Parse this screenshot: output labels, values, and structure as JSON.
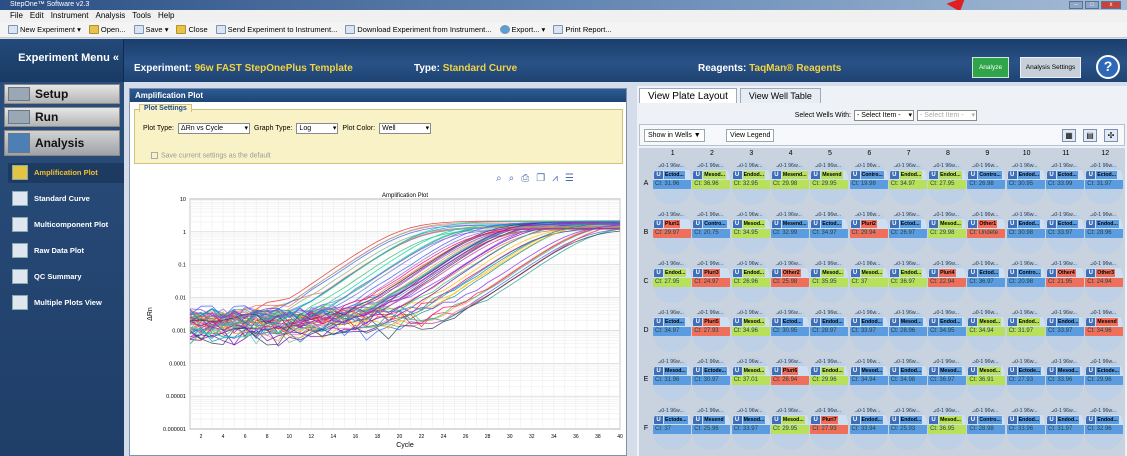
{
  "window": {
    "title": "StepOne™ Software v2.3"
  },
  "menu": [
    "File",
    "Edit",
    "Instrument",
    "Analysis",
    "Tools",
    "Help"
  ],
  "toolbar": {
    "new_experiment": "New Experiment",
    "open": "Open...",
    "save": "Save",
    "close": "Close",
    "send": "Send Experiment to Instrument...",
    "download": "Download Experiment from Instrument...",
    "export": "Export...",
    "print": "Print Report..."
  },
  "header": {
    "experiment_menu": "Experiment Menu «",
    "experiment_label": "Experiment:",
    "experiment_value": "96w FAST StepOnePlus Template",
    "type_label": "Type:",
    "type_value": "Standard Curve",
    "reagents_label": "Reagents:",
    "reagents_value": "TaqMan® Reagents",
    "analyze": "Analyze",
    "analysis_settings": "Analysis Settings",
    "help": "?"
  },
  "sidebar": {
    "setup": "Setup",
    "run": "Run",
    "analysis": "Analysis",
    "items": [
      "Amplification Plot",
      "Standard Curve",
      "Multicomponent Plot",
      "Raw Data Plot",
      "QC Summary",
      "Multiple Plots View"
    ]
  },
  "left_panel": {
    "title": "Amplification Plot",
    "settings_tab": "Plot Settings",
    "plot_type_label": "Plot Type:",
    "plot_type": "ΔRn vs Cycle",
    "graph_type_label": "Graph Type:",
    "graph_type": "Log",
    "plot_color_label": "Plot Color:",
    "plot_color": "Well",
    "save_default": "Save current settings as the default"
  },
  "chart_data": {
    "type": "line",
    "title": "Amplification Plot",
    "xlabel": "Cycle",
    "ylabel": "ΔRn",
    "y_scale": "log",
    "ylim": [
      1e-06,
      10
    ],
    "xlim": [
      1,
      40
    ],
    "ytick_labels": [
      "10",
      "1",
      "0.1",
      "0.01",
      "0.001",
      "0.0001",
      "0.00001",
      "0.000001"
    ],
    "xtick_labels": [
      "2",
      "4",
      "6",
      "8",
      "10",
      "12",
      "14",
      "16",
      "18",
      "20",
      "22",
      "24",
      "26",
      "28",
      "30",
      "32",
      "34",
      "36",
      "38",
      "40"
    ],
    "grid": true,
    "series_note": "",
    "threshold_range_ct": [
      20,
      38
    ],
    "plateau": 2
  },
  "right_panel": {
    "tab_plate": "View Plate Layout",
    "tab_table": "View Well Table",
    "select_label": "Select Wells With:",
    "select1": "- Select Item -",
    "select2": "- Select Item -",
    "show_in_wells": "Show in Wells ▼",
    "view_legend": "View Legend"
  },
  "plate": {
    "columns": [
      "1",
      "2",
      "3",
      "4",
      "5",
      "6",
      "7",
      "8",
      "9",
      "10",
      "11",
      "12"
    ],
    "rows": [
      "A",
      "B",
      "C",
      "D",
      "E",
      "F"
    ],
    "well_name": "A50-1 96w...",
    "wells": [
      [
        [
          "Ectod...",
          "Ct: 31.96",
          "b"
        ],
        [
          "Mesod...",
          "Ct: 36.96",
          "g"
        ],
        [
          "Endod...",
          "Ct: 32.95",
          "g"
        ],
        [
          "Mesend...",
          "Ct: 29.98",
          "g"
        ],
        [
          "Mesend",
          "Ct: 29.95",
          "g"
        ],
        [
          "Contro...",
          "Ct: 19.98",
          "b"
        ],
        [
          "Endod...",
          "Ct: 34.97",
          "g"
        ],
        [
          "Endod...",
          "Ct: 27.95",
          "g"
        ],
        [
          "Contro...",
          "Ct: 26.98",
          "b"
        ],
        [
          "Endod...",
          "Ct: 30.95",
          "b"
        ],
        [
          "Ectod...",
          "Ct: 33.99",
          "b"
        ],
        [
          "Ectod...",
          "Ct: 31.97",
          "b"
        ]
      ],
      [
        [
          "Pluri1",
          "Ct: 29.97",
          "r"
        ],
        [
          "Contro...",
          "Ct: 20.75",
          "b"
        ],
        [
          "Mesod...",
          "Ct: 34.95",
          "g"
        ],
        [
          "Mesend...",
          "Ct: 32.99",
          "b"
        ],
        [
          "Ectod...",
          "Ct: 34.97",
          "b"
        ],
        [
          "Pluri2",
          "Ct: 29.94",
          "r"
        ],
        [
          "Ectod...",
          "Ct: 26.97",
          "b"
        ],
        [
          "Mesod...",
          "Ct: 29.98",
          "g"
        ],
        [
          "Other1",
          "Ct: Undete",
          "r"
        ],
        [
          "Endod...",
          "Ct: 30.98",
          "b"
        ],
        [
          "Ectod...",
          "Ct: 33.97",
          "b"
        ],
        [
          "Endod...",
          "Ct: 28.96",
          "b"
        ]
      ],
      [
        [
          "Endod...",
          "Ct: 27.95",
          "g"
        ],
        [
          "Pluri3",
          "Ct: 24.97",
          "r"
        ],
        [
          "Endod...",
          "Ct: 26.96",
          "g"
        ],
        [
          "Other2",
          "Ct: 25.98",
          "r"
        ],
        [
          "Mesod...",
          "Ct: 35.95",
          "g"
        ],
        [
          "Mesod...",
          "Ct: 37",
          "g"
        ],
        [
          "Endod...",
          "Ct: 36.97",
          "g"
        ],
        [
          "Pluri4",
          "Ct: 22.94",
          "r"
        ],
        [
          "Ectod...",
          "Ct: 36.97",
          "b"
        ],
        [
          "Contro...",
          "Ct: 20.98",
          "b"
        ],
        [
          "Other4",
          "Ct: 21.95",
          "r"
        ],
        [
          "Other3",
          "Ct: 24.94",
          "r"
        ]
      ],
      [
        [
          "Ectod...",
          "Ct: 34.97",
          "b"
        ],
        [
          "Pluri5",
          "Ct: 27.93",
          "r"
        ],
        [
          "Mesod...",
          "Ct: 34.96",
          "g"
        ],
        [
          "Ectod...",
          "Ct: 30.95",
          "b"
        ],
        [
          "Endod...",
          "Ct: 28.97",
          "b"
        ],
        [
          "Endod...",
          "Ct: 33.97",
          "b"
        ],
        [
          "Mesod...",
          "Ct: 28.96",
          "b"
        ],
        [
          "Endod...",
          "Ct: 34.95",
          "b"
        ],
        [
          "Mesod...",
          "Ct: 34.94",
          "g"
        ],
        [
          "Endod...",
          "Ct: 31.97",
          "g"
        ],
        [
          "Endod...",
          "Ct: 33.97",
          "b"
        ],
        [
          "Mesend",
          "Ct: 34.96",
          "r"
        ]
      ],
      [
        [
          "Mesod...",
          "Ct: 31.96",
          "b"
        ],
        [
          "Ectode...",
          "Ct: 30.97",
          "b"
        ],
        [
          "Mesod...",
          "Ct: 37.01",
          "g"
        ],
        [
          "Pluri6",
          "Ct: 26.94",
          "r"
        ],
        [
          "Endod...",
          "Ct: 29.96",
          "g"
        ],
        [
          "Mesod...",
          "Ct: 34.94",
          "b"
        ],
        [
          "Endod...",
          "Ct: 34.98",
          "b"
        ],
        [
          "Mesod...",
          "Ct: 36.97",
          "b"
        ],
        [
          "Mesod...",
          "Ct: 36.91",
          "g"
        ],
        [
          "Ectode...",
          "Ct: 27.93",
          "b"
        ],
        [
          "Mesod...",
          "Ct: 33.96",
          "b"
        ],
        [
          "Ectode...",
          "Ct: 29.96",
          "b"
        ]
      ],
      [
        [
          "Ectode...",
          "Ct: 37",
          "b"
        ],
        [
          "Mesend",
          "Ct: 25.96",
          "b"
        ],
        [
          "Mesod...",
          "Ct: 33.97",
          "b"
        ],
        [
          "Mesod...",
          "Ct: 29.95",
          "g"
        ],
        [
          "Pluri7",
          "Ct: 27.93",
          "r"
        ],
        [
          "Endod...",
          "Ct: 33.94",
          "b"
        ],
        [
          "Endod...",
          "Ct: 25.93",
          "b"
        ],
        [
          "Mesod...",
          "Ct: 36.95",
          "g"
        ],
        [
          "Contro...",
          "Ct: 28.98",
          "b"
        ],
        [
          "Endod...",
          "Ct: 33.96",
          "b"
        ],
        [
          "Endod...",
          "Ct: 31.97",
          "b"
        ],
        [
          "Endod...",
          "Ct: 32.96",
          "b"
        ]
      ]
    ]
  },
  "colors": {
    "blue_tag": "#5b9be0",
    "green_tag": "#b8e05a",
    "red_tag": "#ef6f5a"
  }
}
